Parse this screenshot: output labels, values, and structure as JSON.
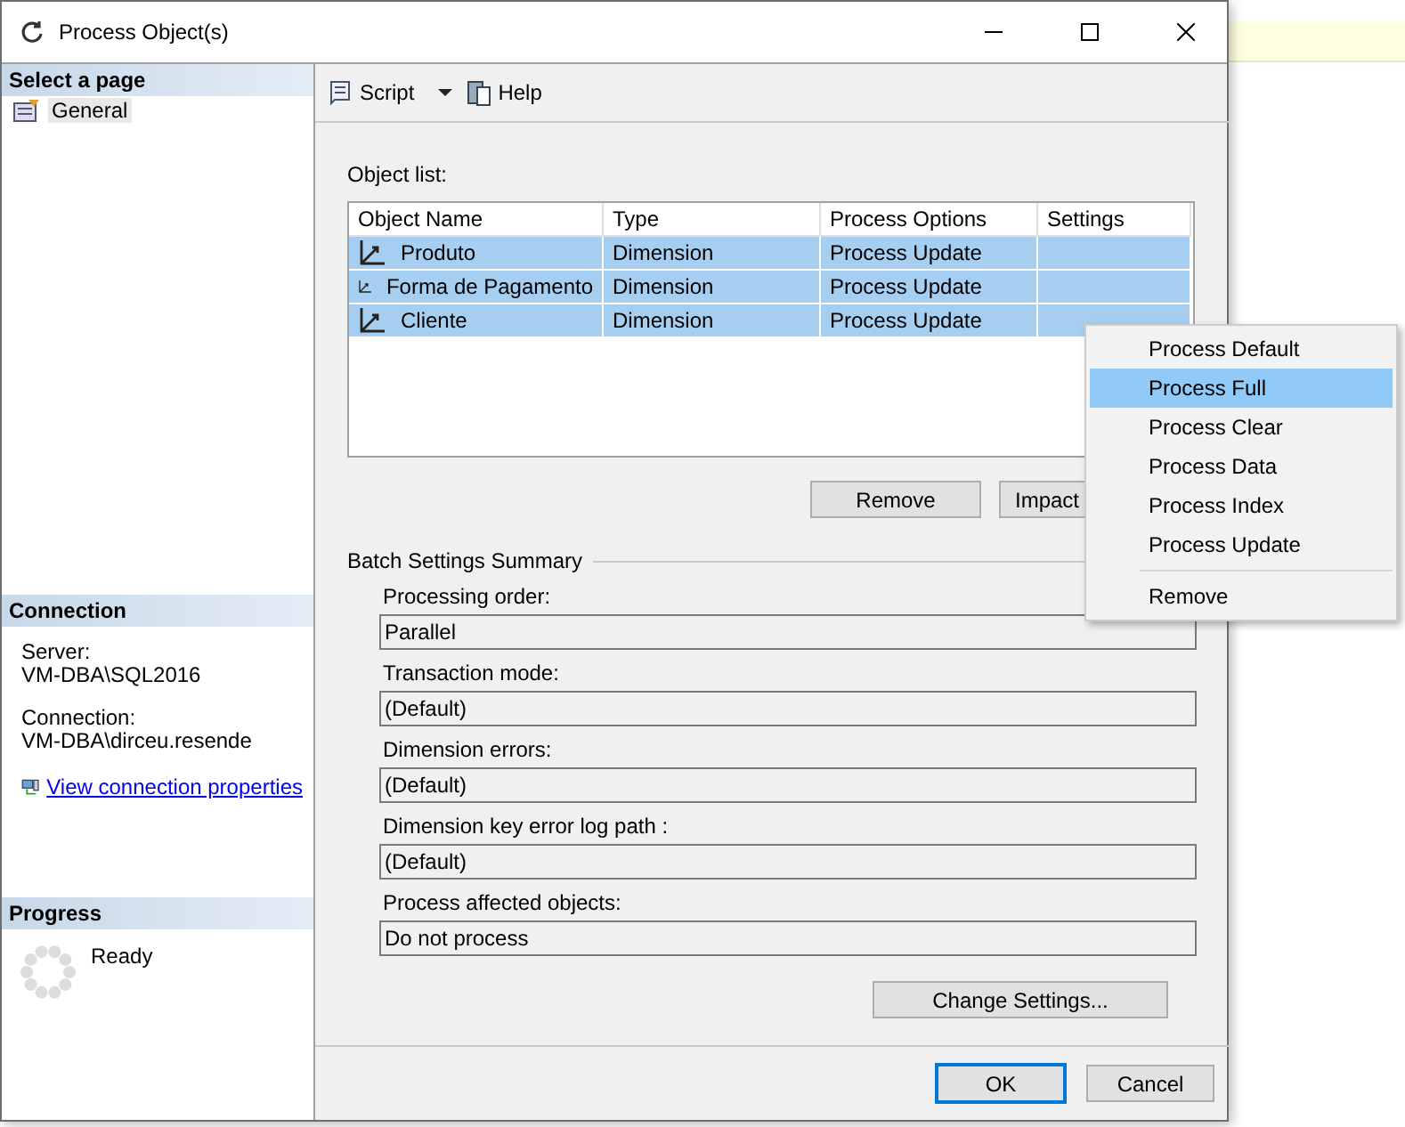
{
  "window": {
    "title": "Process Object(s)"
  },
  "sidebar": {
    "select_heading": "Select a page",
    "pages": [
      {
        "label": "General",
        "selected": true
      }
    ],
    "connection_heading": "Connection",
    "connection_fields": [
      {
        "label": "Server:",
        "value": "VM-DBA\\SQL2016"
      },
      {
        "label": "Connection:",
        "value": "VM-DBA\\dirceu.resende"
      }
    ],
    "connection_link": "View connection properties",
    "progress_heading": "Progress",
    "progress_status": "Ready"
  },
  "toolbar": {
    "script": "Script",
    "help": "Help"
  },
  "object_list": {
    "label": "Object list:",
    "columns": [
      "Object Name",
      "Type",
      "Process Options",
      "Settings"
    ],
    "rows": [
      {
        "name": "Produto",
        "type": "Dimension",
        "options": "Process Update",
        "selected": true
      },
      {
        "name": "Forma de Pagamento",
        "type": "Dimension",
        "options": "Process Update",
        "selected": true
      },
      {
        "name": "Cliente",
        "type": "Dimension",
        "options": "Process Update",
        "selected": true
      }
    ],
    "buttons": [
      "Remove",
      "Impact"
    ]
  },
  "batch": {
    "title": "Batch Settings Summary",
    "fields": [
      {
        "label": "Processing order:",
        "value": "Parallel"
      },
      {
        "label": "Transaction mode:",
        "value": "(Default)"
      },
      {
        "label": "Dimension errors:",
        "value": "(Default)"
      },
      {
        "label": "Dimension key error log path :",
        "value": "(Default)"
      },
      {
        "label": "Process affected objects:",
        "value": "Do not process"
      }
    ],
    "button": "Change Settings..."
  },
  "footer": {
    "ok": "OK",
    "cancel": "Cancel"
  },
  "context_menu": [
    {
      "kind": "option",
      "label": "Process Default",
      "selected": false
    },
    {
      "kind": "option",
      "label": "Process Full",
      "selected": true
    },
    {
      "kind": "option",
      "label": "Process Clear",
      "selected": false
    },
    {
      "kind": "option",
      "label": "Process Data",
      "selected": false
    },
    {
      "kind": "option",
      "label": "Process Index",
      "selected": false
    },
    {
      "kind": "option",
      "label": "Process Update",
      "selected": false
    },
    {
      "kind": "separator"
    },
    {
      "kind": "option",
      "label": "Remove",
      "selected": false
    }
  ]
}
